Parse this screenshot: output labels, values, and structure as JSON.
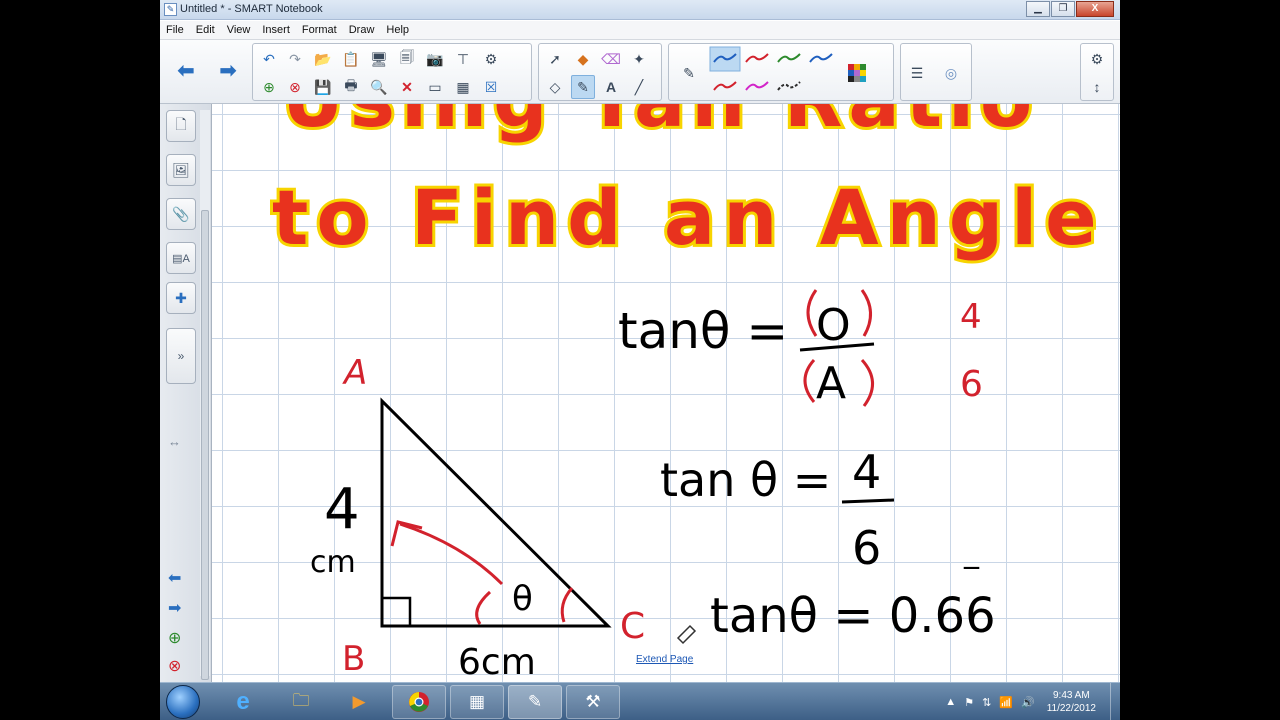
{
  "window": {
    "title": "Untitled * - SMART Notebook",
    "app_icon": "notebook-icon"
  },
  "window_controls": {
    "minimize": "▁",
    "restore": "❐",
    "close": "X"
  },
  "menu": [
    "File",
    "Edit",
    "View",
    "Insert",
    "Format",
    "Draw",
    "Help"
  ],
  "toolbar": {
    "nav": {
      "back": "back-arrow-icon",
      "forward": "forward-arrow-icon"
    },
    "file_tools": [
      "undo-icon",
      "redo-icon",
      "open-file-icon",
      "paste-icon",
      "screen-capture-icon",
      "page-icon",
      "camera-icon",
      "table-icon",
      "plugin-icon",
      "new-page-icon",
      "delete-page-icon",
      "save-icon",
      "print-icon",
      "magnifier-icon",
      "delete-icon",
      "screen-shade-icon",
      "table-insert-icon",
      "close-icon"
    ],
    "draw_tools": [
      "select-icon",
      "shapes-icon",
      "eraser-icon",
      "magic-pen-icon",
      "fill-icon",
      "creative-pen-icon",
      "text-icon",
      "line-icon"
    ],
    "pen_styles": {
      "colors": [
        "#1f5fbf",
        "#d2222d",
        "#2d8a2d",
        "#1f5fbf",
        "#d2222d",
        "#d224c8",
        "#2d2d2d"
      ],
      "active_index": 0
    },
    "properties": [
      "color-palette-icon",
      "line-style-icon",
      "fill-effects-icon"
    ],
    "settings": [
      "gear-icon",
      "move-toolbar-icon"
    ]
  },
  "sidebar": {
    "tabs": [
      "page-sorter-icon",
      "gallery-icon",
      "attachments-icon",
      "properties-icon",
      "addons-icon"
    ],
    "collapse": "»",
    "bottom_tools": [
      "back-arrow-icon",
      "forward-arrow-icon",
      "add-page-icon",
      "delete-page-icon"
    ]
  },
  "canvas": {
    "heading_line1": "Using Tan Ratio",
    "heading_line2": "to Find an Angle",
    "heading_fill": "#e8321e",
    "heading_outline": "#f7d400",
    "triangle": {
      "vertex_a": "A",
      "vertex_b": "B",
      "vertex_c": "C",
      "side_vertical": "4",
      "side_vertical_unit": "cm",
      "side_horizontal": "6cm",
      "angle": "θ"
    },
    "formula_1": {
      "left": "tanθ =",
      "numerator": "O",
      "denominator": "A",
      "note_top": "4",
      "note_bottom": "6"
    },
    "formula_2": {
      "left": "tan θ =",
      "numerator": "4",
      "denominator": "6"
    },
    "formula_3": {
      "text": "tanθ = 0.66",
      "recurring_mark": "‾"
    },
    "extend_page": "Extend Page"
  },
  "taskbar": {
    "items": [
      "internet-explorer-icon",
      "file-explorer-icon",
      "media-player-icon",
      "chrome-icon",
      "calculator-icon",
      "smart-notebook-icon",
      "smart-tools-icon"
    ],
    "tray": [
      "show-hidden-icon",
      "action-center-icon",
      "network-device-icon",
      "signal-icon",
      "volume-icon"
    ],
    "time": "9:43 AM",
    "date": "11/22/2012"
  }
}
